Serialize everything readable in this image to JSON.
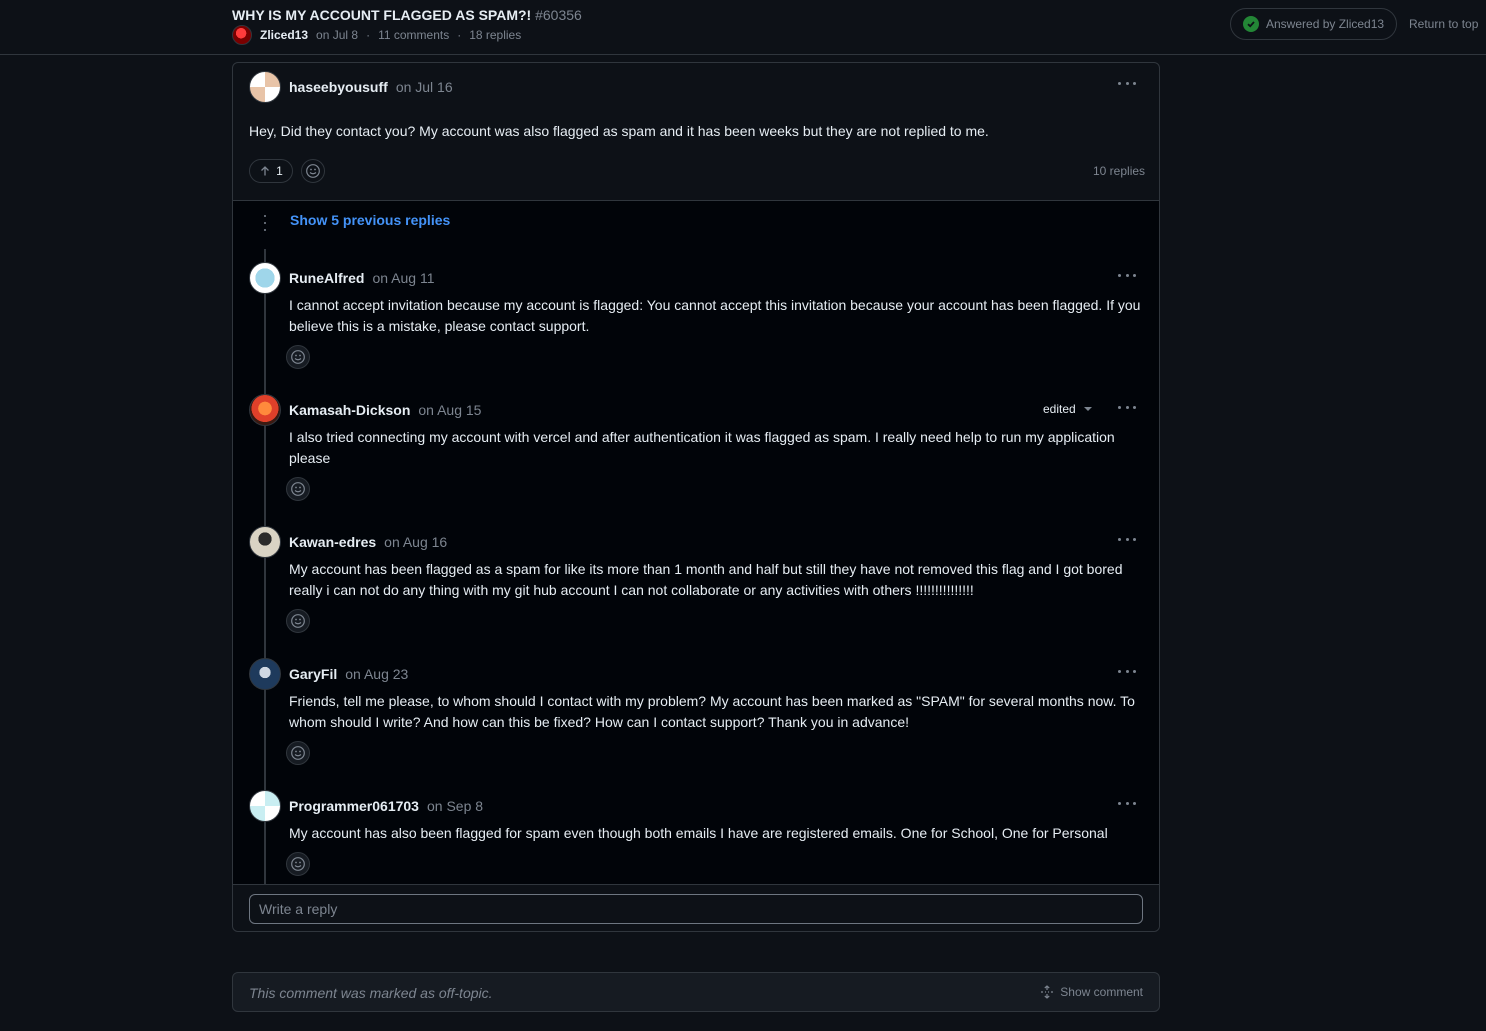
{
  "header": {
    "title": "WHY IS MY ACCOUNT FLAGGED AS SPAM?!",
    "number": "#60356",
    "author": "Zliced13",
    "date": "on Jul 8",
    "sep1": "·",
    "comments": "11 comments",
    "sep2": "·",
    "replies": "18 replies",
    "answered": "Answered by Zliced13",
    "return_top": "Return to top"
  },
  "main_comment": {
    "author": "haseebyousuff",
    "date": "on Jul 16",
    "body": "Hey, Did they contact you? My account was also flagged as spam and it has been weeks but they are not replied to me.",
    "upvotes": "1",
    "replies_count": "10 replies"
  },
  "show_previous": "Show 5 previous replies",
  "replies": [
    {
      "author": "RuneAlfred",
      "date": "on Aug 11",
      "body": "I cannot accept invitation because my account is flagged: You cannot accept this invitation because your account has been flagged. If you believe this is a mistake, please contact support."
    },
    {
      "author": "Kamasah-Dickson",
      "date": "on Aug 15",
      "edited": "edited",
      "body": "I also tried connecting my account with vercel and after authentication it was flagged as spam. I really need help to run my application please"
    },
    {
      "author": "Kawan-edres",
      "date": "on Aug 16",
      "body": "My account has been flagged as a spam for like its more than 1 month and half but still they have not removed this flag and I got bored really i can not do any thing with my git hub account I can not collaborate or any activities with others !!!!!!!!!!!!!!!"
    },
    {
      "author": "GaryFil",
      "date": "on Aug 23",
      "body": "Friends, tell me please, to whom should I contact with my problem? My account has been marked as \"SPAM\" for several months now. To whom should I write? And how can this be fixed? How can I contact support? Thank you in advance!"
    },
    {
      "author": "Programmer061703",
      "date": "on Sep 8",
      "body": "My account has also been flagged for spam even though both emails I have are registered emails. One for School, One for Personal"
    }
  ],
  "reply_input": {
    "placeholder": "Write a reply"
  },
  "offtopic": {
    "text": "This comment was marked as off-topic.",
    "show": "Show comment"
  },
  "colors": {
    "background": "#0d1117",
    "link": "#4493f8",
    "answered_check": "#238636",
    "border": "#30363d"
  }
}
